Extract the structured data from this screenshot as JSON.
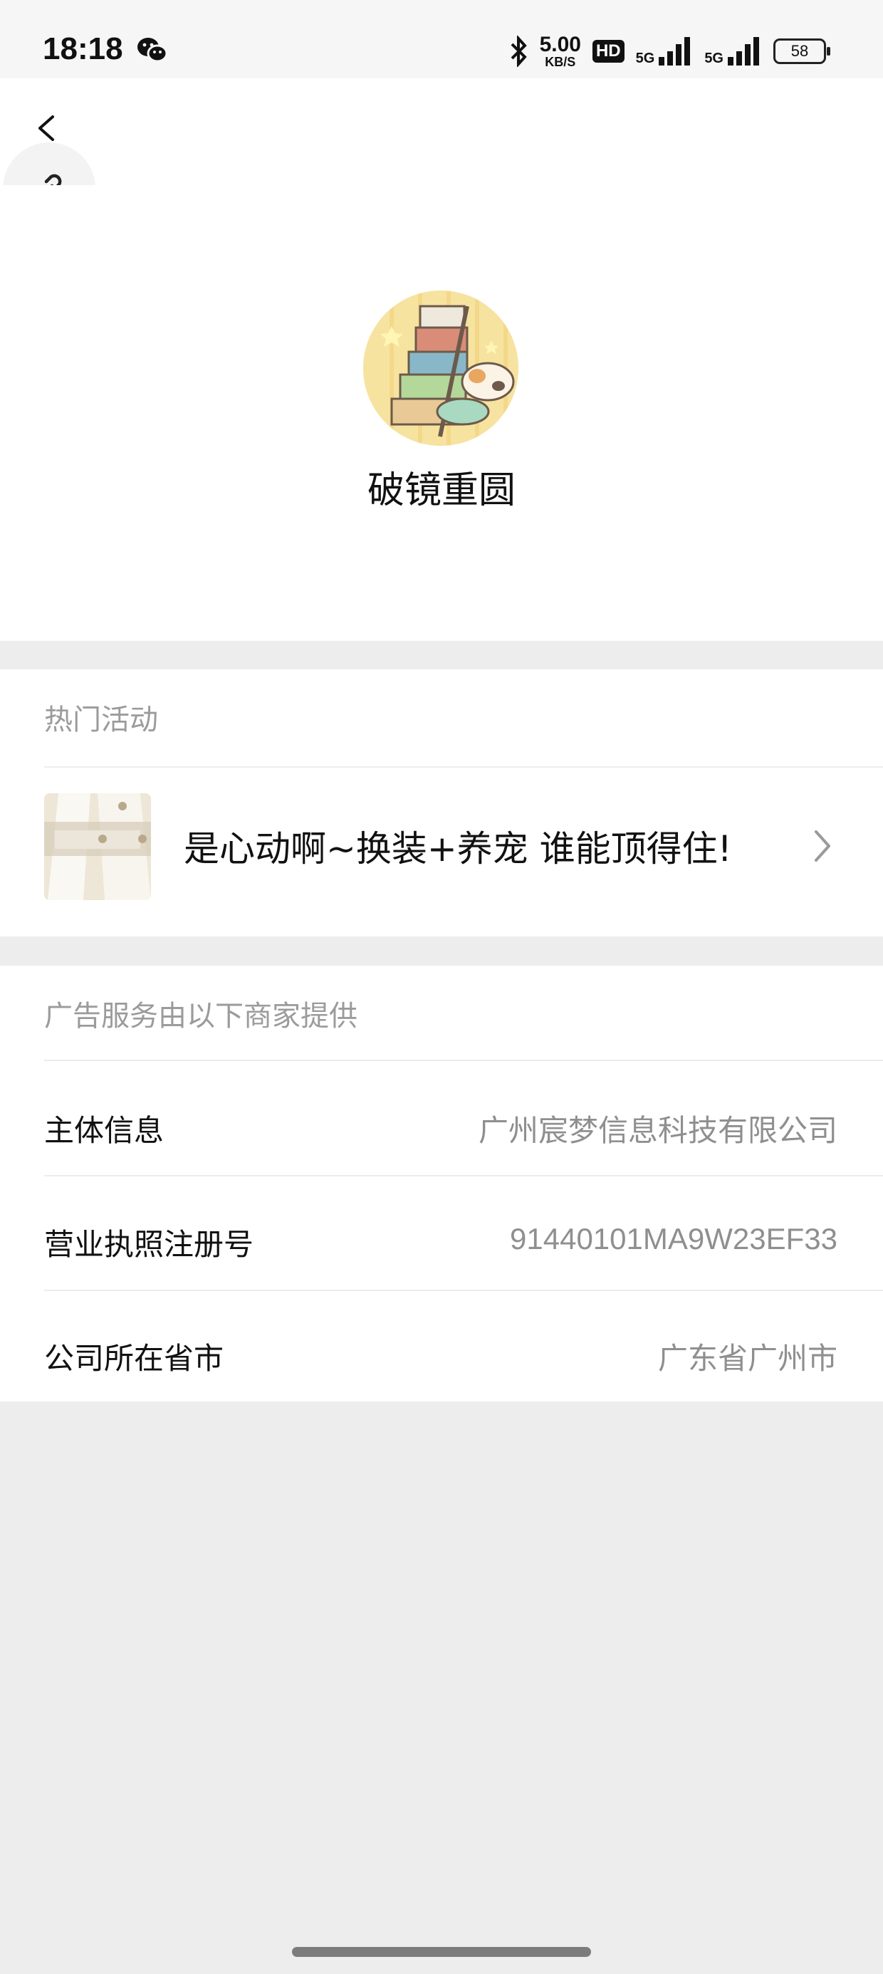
{
  "status_bar": {
    "time": "18:18",
    "net_speed_value": "5.00",
    "net_speed_unit": "KB/S",
    "hd_badge": "HD",
    "sim1_network": "5G",
    "sim2_network": "5G",
    "battery_level": "58",
    "icons": [
      "wechat-icon",
      "bluetooth-icon",
      "signal-icon",
      "battery-icon"
    ]
  },
  "nav": {
    "back_icon": "back-chevron-icon",
    "link_icon": "link-icon"
  },
  "profile": {
    "name": "破镜重圆",
    "avatar": "game-avatar"
  },
  "hot_activity": {
    "title": "热门活动",
    "item_text": "是心动啊~换装+养宠 谁能顶得住!",
    "chevron_icon": "chevron-right-icon"
  },
  "ad_provider": {
    "title": "广告服务由以下商家提供",
    "rows": [
      {
        "label": "主体信息",
        "value": "广州宸梦信息科技有限公司"
      },
      {
        "label": "营业执照注册号",
        "value": "91440101MA9W23EF33"
      },
      {
        "label": "公司所在省市",
        "value": "广东省广州市"
      }
    ]
  },
  "colors": {
    "background": "#ededed",
    "card": "#ffffff",
    "secondary_text": "#8f8f8f"
  }
}
